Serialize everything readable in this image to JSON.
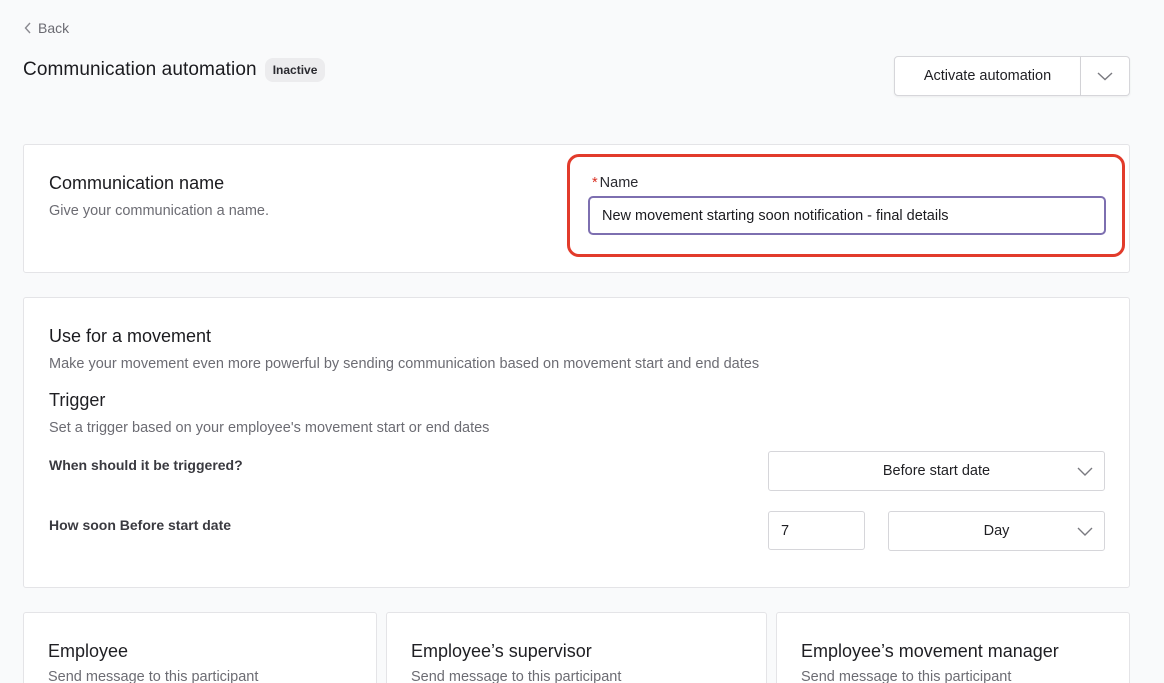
{
  "header": {
    "back_label": "Back",
    "title": "Communication automation",
    "status_badge": "Inactive",
    "activate_label": "Activate automation"
  },
  "name_section": {
    "title": "Communication name",
    "description": "Give your communication a name.",
    "field_required_mark": "*",
    "field_label": "Name",
    "field_value": "New movement starting soon notification - final details"
  },
  "movement_section": {
    "title": "Use for a movement",
    "description": "Make your movement even more powerful by sending communication based on movement start and end dates",
    "trigger_title": "Trigger",
    "trigger_description": "Set a trigger based on your employee's movement start or end dates",
    "when_label": "When should it be triggered?",
    "when_value": "Before start date",
    "how_soon_label": "How soon Before start date",
    "how_soon_number": "7",
    "how_soon_unit": "Day"
  },
  "participants": [
    {
      "title": "Employee",
      "description": "Send message to this participant"
    },
    {
      "title": "Employee’s supervisor",
      "description": "Send message to this participant"
    },
    {
      "title": "Employee’s movement manager",
      "description": "Send message to this participant"
    }
  ],
  "colors": {
    "highlight": "#e23b2b",
    "input_focus": "#7d6fb0",
    "required": "#d92d20"
  }
}
